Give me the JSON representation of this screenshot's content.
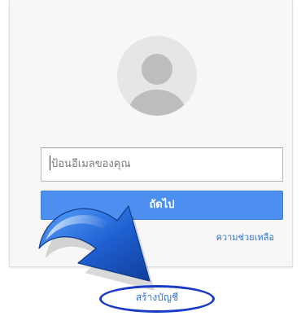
{
  "login": {
    "email_placeholder": "ป้อนอีเมลของคุณ",
    "next_label": "ถัดไป",
    "help_label": "ความช่วยเหลือ",
    "create_account_label": "สร้างบัญชี"
  },
  "colors": {
    "primary": "#4d8ff0",
    "link": "#3273d6",
    "highlight_ring": "#1a3ac8",
    "arrow": "#1e5fd0"
  },
  "icons": {
    "avatar": "default-user-icon",
    "pointer": "curved-arrow-icon"
  }
}
